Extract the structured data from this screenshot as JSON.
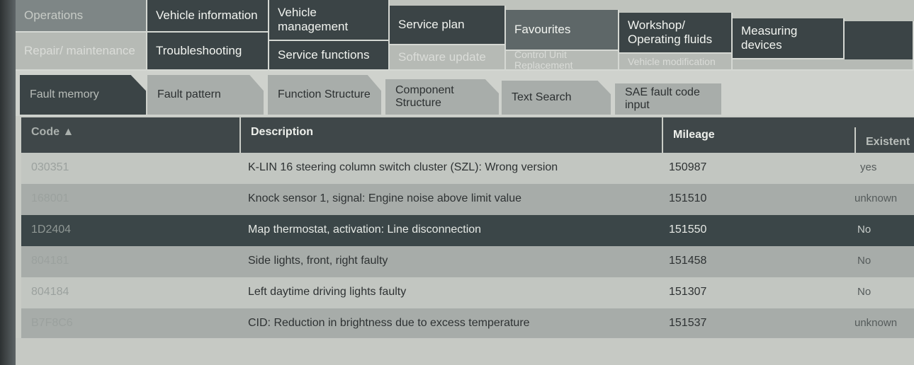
{
  "nav": {
    "row1": [
      "Operations",
      "Vehicle information",
      "Vehicle management",
      "Service plan",
      "Favourites",
      "Workshop/ Operating fluids",
      "Measuring devices"
    ],
    "row2": [
      "Repair/ maintenance",
      "Troubleshooting",
      "Service functions",
      "Software update",
      "Control Unit Replacement",
      "Vehicle modification"
    ]
  },
  "subtabs": [
    "Fault memory",
    "Fault pattern",
    "Function Structure",
    "Component Structure",
    "Text Search",
    "SAE fault code input"
  ],
  "table": {
    "headers": {
      "code": "Code ▲",
      "description": "Description",
      "mileage": "Mileage",
      "existent": "Existent"
    },
    "rows": [
      {
        "code": "030351",
        "description": "K-LIN 16 steering column switch cluster (SZL): Wrong version",
        "mileage": "150987",
        "existent": "yes"
      },
      {
        "code": "168001",
        "description": "Knock sensor 1, signal: Engine noise above limit value",
        "mileage": "151510",
        "existent": "unknown"
      },
      {
        "code": "1D2404",
        "description": "Map thermostat, activation: Line disconnection",
        "mileage": "151550",
        "existent": "No"
      },
      {
        "code": "804181",
        "description": "Side lights, front, right faulty",
        "mileage": "151458",
        "existent": "No"
      },
      {
        "code": "804184",
        "description": "Left daytime driving lights faulty",
        "mileage": "151307",
        "existent": "No"
      },
      {
        "code": "B7F8C6",
        "description": "CID: Reduction in brightness due to excess temperature",
        "mileage": "151537",
        "existent": "unknown"
      }
    ]
  }
}
